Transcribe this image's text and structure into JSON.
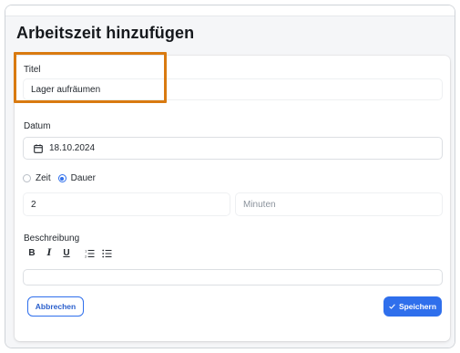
{
  "page": {
    "title": "Arbeitszeit hinzufügen"
  },
  "form": {
    "title_label": "Titel",
    "title_value": "Lager aufräumen",
    "date_label": "Datum",
    "date_value": "18.10.2024",
    "mode_options": [
      {
        "label": "Zeit",
        "checked": false
      },
      {
        "label": "Dauer",
        "checked": true
      }
    ],
    "duration_hours_value": "2",
    "duration_minutes_placeholder": "Minuten",
    "description_label": "Beschreibung",
    "toolbar": {
      "bold": "B",
      "italic": "I",
      "underline": "U"
    }
  },
  "buttons": {
    "cancel_label": "Abbrechen",
    "save_label": "Speichern"
  },
  "colors": {
    "accent": "#2f6fec",
    "highlight": "#d97a10"
  },
  "icons": {
    "date": "calendar-icon",
    "save": "check-icon",
    "ordered_list": "ordered-list-icon",
    "bullet_list": "bullet-list-icon"
  }
}
